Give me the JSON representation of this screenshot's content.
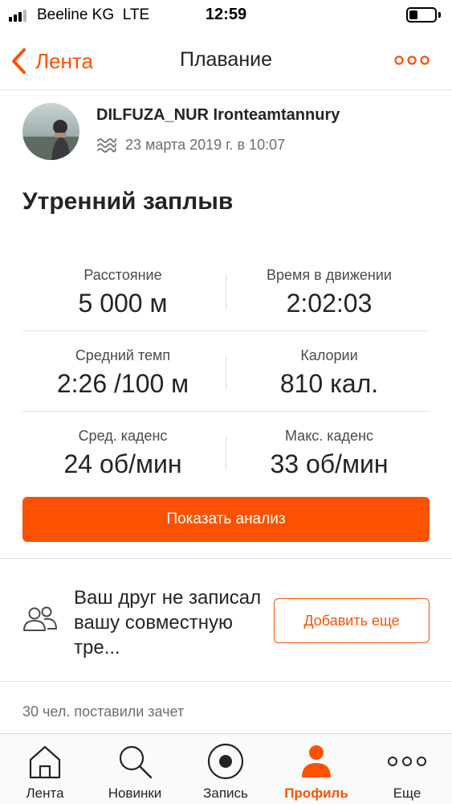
{
  "status_bar": {
    "carrier": "Beeline KG",
    "network": "LTE",
    "time": "12:59"
  },
  "nav": {
    "back_label": "Лента",
    "title": "Плавание"
  },
  "athlete": {
    "name": "DILFUZA_NUR Ironteamtannury",
    "date": "23 марта 2019 г. в 10:07"
  },
  "activity": {
    "title": "Утренний заплыв"
  },
  "stats": [
    {
      "left": {
        "label": "Расстояние",
        "value": "5 000 м"
      },
      "right": {
        "label": "Время в движении",
        "value": "2:02:03"
      }
    },
    {
      "left": {
        "label": "Средний темп",
        "value": "2:26 /100 м"
      },
      "right": {
        "label": "Калории",
        "value": "810 кал."
      }
    },
    {
      "left": {
        "label": "Сред. каденс",
        "value": "24 об/мин"
      },
      "right": {
        "label": "Макс. каденс",
        "value": "33 об/мин"
      }
    }
  ],
  "analysis_button": "Показать анализ",
  "friend_prompt": {
    "text": "Ваш друг не записал вашу совместную тре...",
    "button": "Добавить еще"
  },
  "kudos": "30 чел. поставили зачет",
  "tabs": [
    {
      "label": "Лента",
      "icon": "home-icon"
    },
    {
      "label": "Новинки",
      "icon": "search-icon"
    },
    {
      "label": "Запись",
      "icon": "record-icon"
    },
    {
      "label": "Профиль",
      "icon": "profile-icon",
      "active": true
    },
    {
      "label": "Еще",
      "icon": "more-icon"
    }
  ],
  "colors": {
    "accent": "#fc5200",
    "text": "#242428",
    "muted": "#6d6d78"
  }
}
